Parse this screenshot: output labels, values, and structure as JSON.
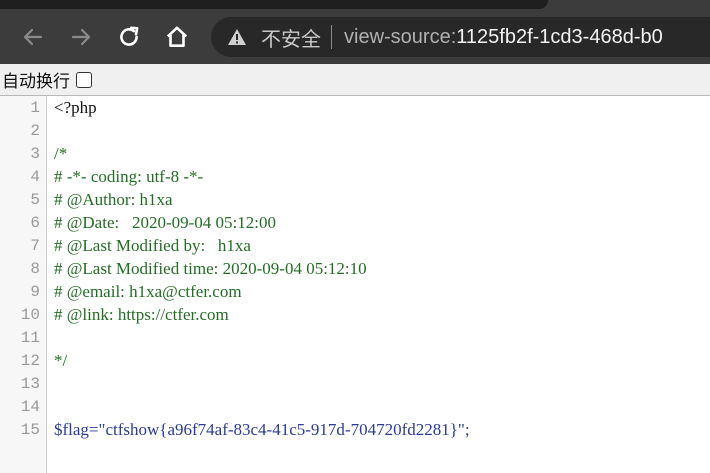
{
  "toolbar": {
    "security_label": "不安全",
    "url_scheme": "view-source:",
    "url_host": "1125fb2f-1cd3-468d-b0"
  },
  "wrapbar": {
    "label": "自动换行",
    "checked": false
  },
  "source": {
    "lines": [
      {
        "num": "1",
        "text": "<?php"
      },
      {
        "num": "2",
        "text": ""
      },
      {
        "num": "3",
        "text": "/*"
      },
      {
        "num": "4",
        "text": "# -*- coding: utf-8 -*-"
      },
      {
        "num": "5",
        "text": "# @Author: h1xa"
      },
      {
        "num": "6",
        "text": "# @Date:   2020-09-04 05:12:00"
      },
      {
        "num": "7",
        "text": "# @Last Modified by:   h1xa"
      },
      {
        "num": "8",
        "text": "# @Last Modified time: 2020-09-04 05:12:10"
      },
      {
        "num": "9",
        "text": "# @email: h1xa@ctfer.com"
      },
      {
        "num": "10",
        "text": "# @link: https://ctfer.com"
      },
      {
        "num": "11",
        "text": ""
      },
      {
        "num": "12",
        "text": "*/"
      },
      {
        "num": "13",
        "text": ""
      },
      {
        "num": "14",
        "text": ""
      },
      {
        "num": "15",
        "text": "$flag=\"ctfshow{a96f74af-83c4-41c5-917d-704720fd2281}\";"
      }
    ]
  }
}
